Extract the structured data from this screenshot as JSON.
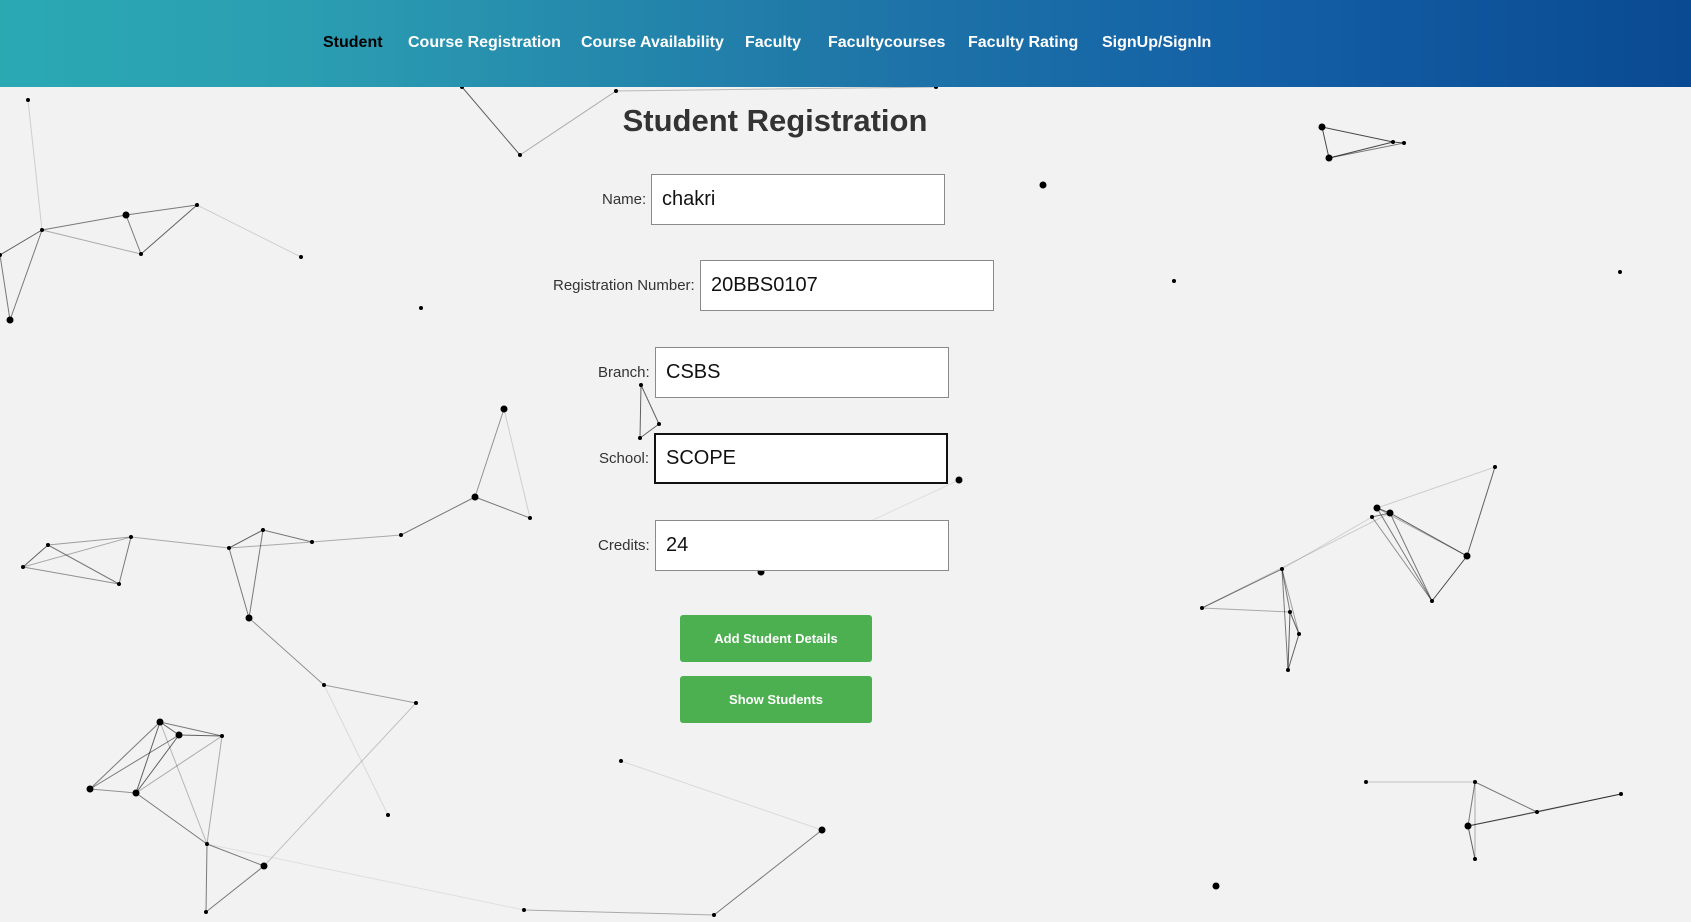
{
  "nav": {
    "items": [
      {
        "label": "Student",
        "active": true
      },
      {
        "label": "Course Registration"
      },
      {
        "label": "Course Availability"
      },
      {
        "label": "Faculty"
      },
      {
        "label": "Facultycourses"
      },
      {
        "label": "Faculty Rating"
      },
      {
        "label": "SignUp/SignIn"
      }
    ]
  },
  "form": {
    "title": "Student Registration",
    "fields": {
      "name": {
        "label": "Name:",
        "value": "chakri"
      },
      "registration_number": {
        "label": "Registration Number:",
        "value": "20BBS0107"
      },
      "branch": {
        "label": "Branch:",
        "value": "CSBS"
      },
      "school": {
        "label": "School:",
        "value": "SCOPE"
      },
      "credits": {
        "label": "Credits:",
        "value": "24"
      }
    },
    "buttons": {
      "add": "Add Student Details",
      "show": "Show Students"
    }
  },
  "colors": {
    "nav_gradient_start": "#2aa9b3",
    "nav_gradient_end": "#0a4a92",
    "button_green": "#4caf50",
    "background": "#f2f2f2"
  }
}
